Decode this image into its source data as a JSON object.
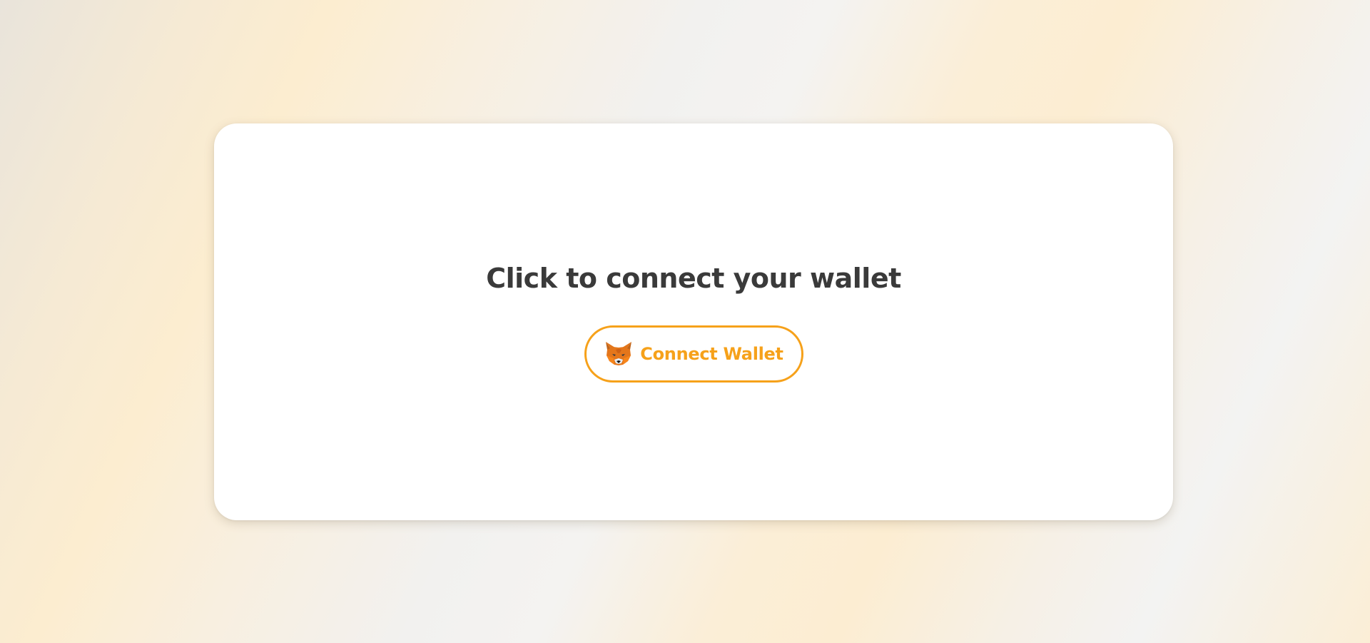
{
  "page": {
    "background_colors": [
      "#e9e4db",
      "#fcedd0",
      "#f3f3f2"
    ]
  },
  "card": {
    "title": "Click to connect your wallet",
    "connect_button": {
      "label": "Connect Wallet",
      "icon": "metamask-fox-icon",
      "accent_color": "#f6a11a"
    }
  }
}
